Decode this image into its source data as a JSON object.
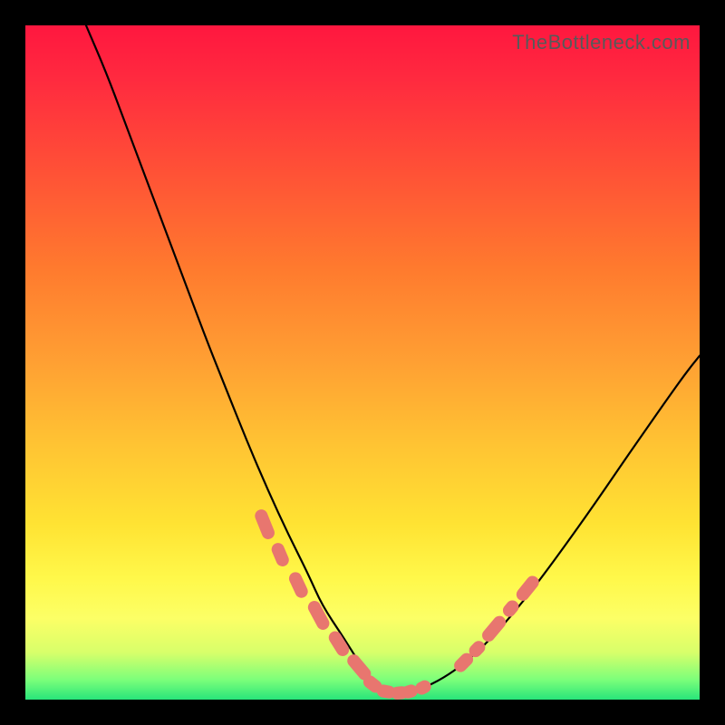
{
  "watermark": "TheBottleneck.com",
  "chart_data": {
    "type": "line",
    "title": "",
    "xlabel": "",
    "ylabel": "",
    "xlim": [
      0,
      100
    ],
    "ylim": [
      0,
      100
    ],
    "series": [
      {
        "name": "left-curve",
        "x": [
          9,
          12,
          15,
          18,
          21,
          24,
          27,
          30,
          33,
          36,
          39,
          42,
          44,
          47,
          49.5,
          51,
          52.5
        ],
        "y": [
          100,
          93,
          85,
          77,
          69,
          61,
          53,
          45.5,
          38,
          31,
          24.5,
          18.5,
          14,
          9.5,
          5.5,
          3.3,
          1.7
        ]
      },
      {
        "name": "right-curve",
        "x": [
          59,
          62,
          65,
          68,
          71,
          74,
          77,
          80,
          83,
          86,
          89,
          92,
          95,
          98,
          100
        ],
        "y": [
          1.7,
          3.2,
          5.3,
          8,
          11.2,
          14.8,
          18.7,
          22.8,
          27,
          31.3,
          35.7,
          40,
          44.3,
          48.5,
          51
        ]
      },
      {
        "name": "floor",
        "x": [
          52.5,
          54,
          55.5,
          57,
          59
        ],
        "y": [
          1.7,
          1.0,
          0.9,
          1.0,
          1.7
        ]
      }
    ],
    "markers": {
      "name": "highlight-capsules",
      "points": [
        {
          "cx": 35.5,
          "cy": 26.0,
          "angle": -68,
          "len": 2.3
        },
        {
          "cx": 37.8,
          "cy": 21.5,
          "angle": -67,
          "len": 1.8
        },
        {
          "cx": 40.5,
          "cy": 17.0,
          "angle": -65,
          "len": 2.0
        },
        {
          "cx": 43.5,
          "cy": 12.5,
          "angle": -62,
          "len": 2.3
        },
        {
          "cx": 46.5,
          "cy": 8.3,
          "angle": -58,
          "len": 2.0
        },
        {
          "cx": 49.5,
          "cy": 4.8,
          "angle": -50,
          "len": 2.2
        },
        {
          "cx": 51.5,
          "cy": 2.3,
          "angle": -38,
          "len": 1.5
        },
        {
          "cx": 53.5,
          "cy": 1.2,
          "angle": -10,
          "len": 1.4
        },
        {
          "cx": 55.5,
          "cy": 1.0,
          "angle": 5,
          "len": 1.3
        },
        {
          "cx": 57.0,
          "cy": 1.2,
          "angle": 18,
          "len": 1.2
        },
        {
          "cx": 59.0,
          "cy": 1.8,
          "angle": 28,
          "len": 1.2
        },
        {
          "cx": 65.0,
          "cy": 5.5,
          "angle": 45,
          "len": 1.6
        },
        {
          "cx": 67.0,
          "cy": 7.5,
          "angle": 46,
          "len": 1.3
        },
        {
          "cx": 69.5,
          "cy": 10.5,
          "angle": 50,
          "len": 2.2
        },
        {
          "cx": 72.0,
          "cy": 13.5,
          "angle": 50,
          "len": 1.3
        },
        {
          "cx": 74.5,
          "cy": 16.5,
          "angle": 51,
          "len": 2.1
        }
      ],
      "radius": 0.95
    },
    "background_gradient": {
      "stops": [
        {
          "pos": 0,
          "color": "#ff173f"
        },
        {
          "pos": 22,
          "color": "#ff5236"
        },
        {
          "pos": 50,
          "color": "#ffa033"
        },
        {
          "pos": 74,
          "color": "#ffe333"
        },
        {
          "pos": 88,
          "color": "#fcff66"
        },
        {
          "pos": 100,
          "color": "#28e57a"
        }
      ]
    }
  }
}
